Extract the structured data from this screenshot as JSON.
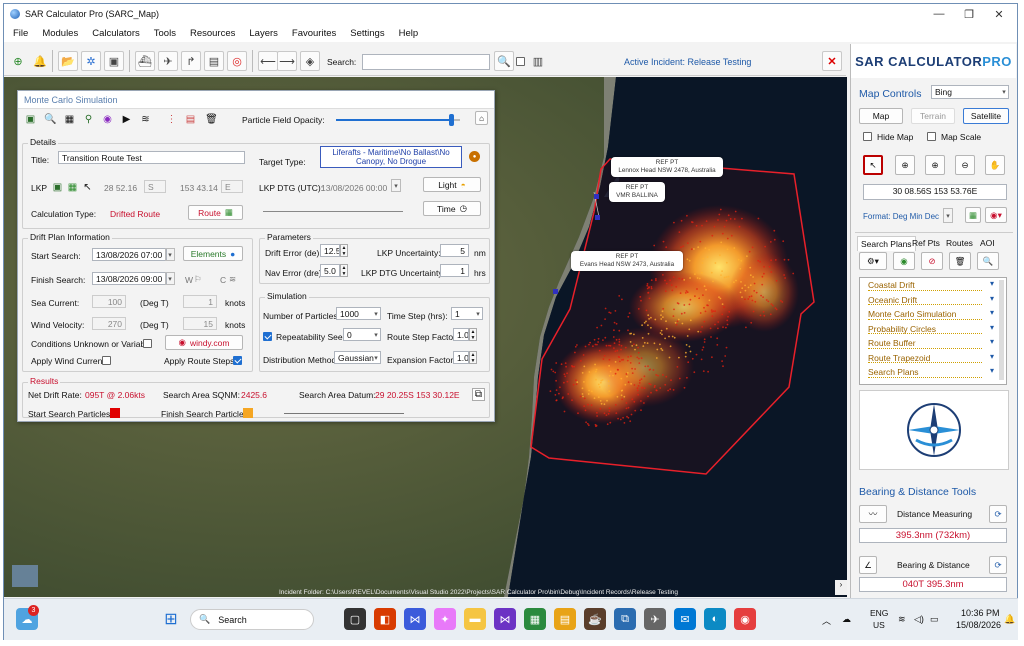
{
  "window": {
    "title": "SAR Calculator Pro (SARC_Map)"
  },
  "menu": [
    "File",
    "Modules",
    "Calculators",
    "Tools",
    "Resources",
    "Layers",
    "Favourites",
    "Settings",
    "Help"
  ],
  "toolbar": {
    "search_label": "Search:",
    "search_value": "",
    "active_incident": "Active Incident: Release Testing"
  },
  "map": {
    "callouts": [
      {
        "line1": "REF PT",
        "line2": "Lennox Head NSW 2478, Australia"
      },
      {
        "line1": "REF PT",
        "line2": "VMR BALLINA"
      },
      {
        "line1": "REF PT",
        "line2": "Evans Head NSW 2473, Australia"
      }
    ],
    "status_path": "Incident Folder: C:\\Users\\REVEL\\Documents\\Visual Studio 2022\\Projects\\SAR Calculator Pro\\bin\\Debug\\Incident Records\\Release Testing"
  },
  "dialog": {
    "title": "Monte Carlo Simulation",
    "opacity_label": "Particle Field Opacity:",
    "opacity_value": 0.93,
    "details": {
      "group": "Details",
      "title_label": "Title:",
      "title_value": "Transition Route Test",
      "target_label": "Target Type:",
      "target_value": "Liferafts - Maritime\\No Ballast\\No Canopy, No Drogue",
      "lkp_label": "LKP",
      "lkp_lat": "28 52.16",
      "lkp_lat_hem": "S",
      "lkp_lon": "153 43.14",
      "lkp_lon_hem": "E",
      "lkp_dtg_label": "LKP DTG (UTC):",
      "lkp_dtg_value": "13/08/2026 00:00",
      "light_label": "Light",
      "time_label": "Time",
      "calc_type_label": "Calculation Type:",
      "calc_type_value": "Drifted Route",
      "route_label": "Route"
    },
    "drift": {
      "group": "Drift Plan Information",
      "start_label": "Start Search:",
      "start_value": "13/08/2026 07:00",
      "finish_label": "Finish Search:",
      "finish_value": "13/08/2026 09:00",
      "elements_label": "Elements",
      "sea_current_label": "Sea Current:",
      "sea_current_deg": "100",
      "deg_unit": "(Deg T)",
      "sea_current_kts": "1",
      "knots_unit": "knots",
      "wind_label": "Wind Velocity:",
      "wind_deg": "270",
      "wind_kts": "15",
      "conditions_label": "Conditions Unknown or Variable",
      "windy_label": "windy.com",
      "apply_wind_label": "Apply Wind Current",
      "apply_route_label": "Apply Route Steps",
      "w_label": "W",
      "c_label": "C"
    },
    "params": {
      "group": "Parameters",
      "drift_err_label": "Drift Error (de):",
      "drift_err_value": "12.5",
      "nav_err_label": "Nav Error (dre):",
      "nav_err_value": "5.0",
      "lkp_unc_label": "LKP Uncertainty:",
      "lkp_unc_value": "5",
      "lkp_unc_unit": "nm",
      "lkp_dtg_unc_label": "LKP DTG Uncertainty:",
      "lkp_dtg_unc_value": "1",
      "lkp_dtg_unc_unit": "hrs"
    },
    "simulation": {
      "group": "Simulation",
      "particles_label": "Number of Particles:",
      "particles_value": "1000",
      "time_step_label": "Time Step (hrs):",
      "time_step_value": "1",
      "seed_label": "Repeatability Seed:",
      "seed_value": "0",
      "route_step_label": "Route Step Factor:",
      "route_step_value": "1.0",
      "dist_label": "Distribution Method:",
      "dist_value": "Gaussian",
      "expansion_label": "Expansion Factor:",
      "expansion_value": "1.0"
    },
    "results": {
      "group": "Results",
      "net_drift_label": "Net Drift Rate:",
      "net_drift_value": "095T @ 2.06kts",
      "area_label": "Search Area SQNM:",
      "area_value": "2425.6",
      "datum_label": "Search Area Datum:",
      "datum_value": "29 20.25S  153 30.12E",
      "start_particles_label": "Start Search Particles:",
      "finish_particles_label": "Finish Search Particles::"
    }
  },
  "right_panel": {
    "logo_main": "SAR CALCULATOR ",
    "logo_accent": "PRO",
    "map_controls_label": "Map Controls",
    "basemap": "Bing",
    "map_btn": "Map",
    "terrain_btn": "Terrain",
    "satellite_btn": "Satellite",
    "hide_map": "Hide Map",
    "map_scale": "Map Scale",
    "coords": "30 08.56S  153 53.76E",
    "format": "Format: Deg Min Dec",
    "tabs": [
      "Search Plans",
      "Ref Pts",
      "Routes",
      "AOI"
    ],
    "plans": [
      "Coastal Drift",
      "Oceanic Drift",
      "Monte Carlo Simulation",
      "Probability Circles",
      "Route Buffer",
      "Route Trapezoid",
      "Search Plans"
    ],
    "bearing_header": "Bearing & Distance Tools",
    "distance_btn": "Distance Measuring",
    "distance_value": "395.3nm  (732km)",
    "bearing_btn": "Bearing & Distance",
    "bearing_value": "040T  395.3nm"
  },
  "taskbar": {
    "search": "Search",
    "lang1": "ENG",
    "lang2": "US",
    "time": "10:36 PM",
    "date": "15/08/2026",
    "weather_badge": "3"
  },
  "colors": {
    "accent": "#1f5aa8",
    "red": "#c8102e",
    "start_particle": "#e00000",
    "finish_particle": "#f5a623"
  }
}
